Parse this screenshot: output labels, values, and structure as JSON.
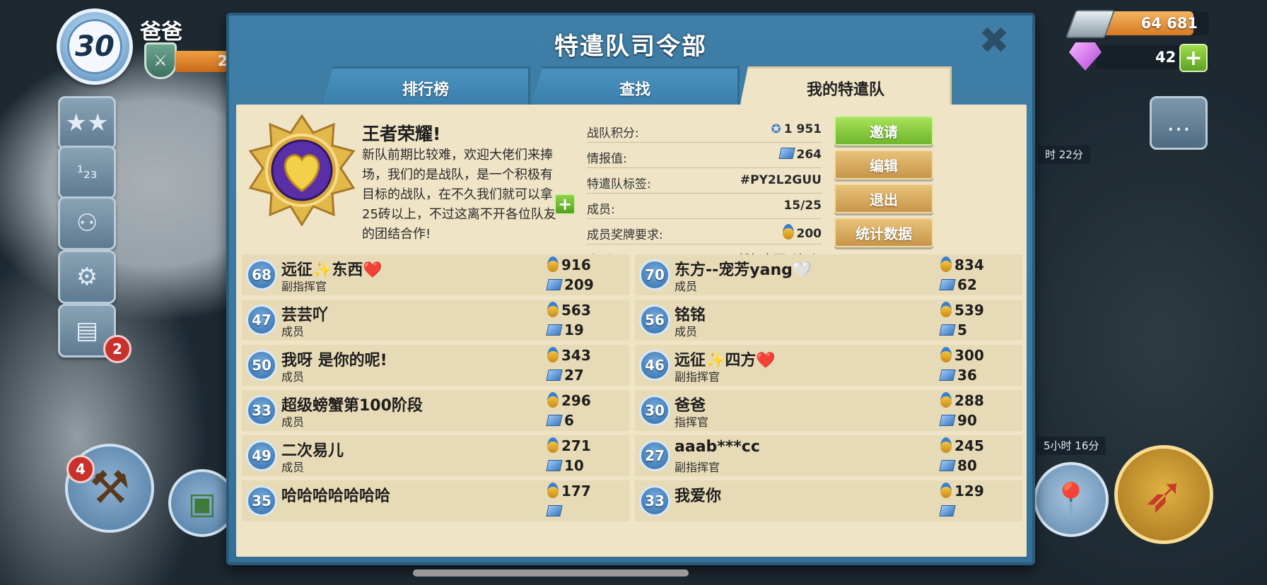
{
  "hud": {
    "player_level": "30",
    "player_name": "爸爸",
    "medal_partial": "2",
    "iron": "64 681",
    "gems": "42",
    "side_badge_count": "2",
    "builder_count": "4",
    "timer_1": "时 22分",
    "timer_2": "5小时 16分"
  },
  "panel": {
    "title": "特遣队司令部",
    "tabs": [
      "排行榜",
      "查找",
      "我的特遣队"
    ],
    "active_tab": 2
  },
  "team": {
    "name": "王者荣耀!",
    "description": "新队前期比较难，欢迎大佬们来捧场，我们的是战队，是一个积极有目标的战队，在不久我们就可以拿25砖以上，不过这离不开各位队友的团结合作!",
    "stats": [
      {
        "label": "战队积分:",
        "value": "1 951"
      },
      {
        "label": "情报值:",
        "value": "264"
      },
      {
        "label": "特遣队标签:",
        "value": "#PY2L2GUU"
      },
      {
        "label": "成员:",
        "value": "15/25"
      },
      {
        "label": "成员奖牌要求:",
        "value": "200"
      },
      {
        "label": "类型:",
        "value": "任何人可以加入"
      }
    ],
    "buttons": [
      "邀请",
      "编辑",
      "退出",
      "统计数据"
    ]
  },
  "members": [
    {
      "level": "68",
      "name": "远征✨东西❤️",
      "role": "副指挥官",
      "medals": "916",
      "intel": "209"
    },
    {
      "level": "70",
      "name": "东方--宠芳yang🤍",
      "role": "成员",
      "medals": "834",
      "intel": "62"
    },
    {
      "level": "47",
      "name": "芸芸吖",
      "role": "成员",
      "medals": "563",
      "intel": "19"
    },
    {
      "level": "56",
      "name": "铭铭",
      "role": "成员",
      "medals": "539",
      "intel": "5"
    },
    {
      "level": "50",
      "name": "我呀 是你的呢!",
      "role": "成员",
      "medals": "343",
      "intel": "27"
    },
    {
      "level": "46",
      "name": "远征✨四方❤️",
      "role": "副指挥官",
      "medals": "300",
      "intel": "36"
    },
    {
      "level": "33",
      "name": "超级螃蟹第100阶段",
      "role": "成员",
      "medals": "296",
      "intel": "6"
    },
    {
      "level": "30",
      "name": "爸爸",
      "role": "指挥官",
      "medals": "288",
      "intel": "90"
    },
    {
      "level": "49",
      "name": "二次易儿",
      "role": "成员",
      "medals": "271",
      "intel": "10"
    },
    {
      "level": "27",
      "name": "aaab***cc",
      "role": "副指挥官",
      "medals": "245",
      "intel": "80"
    },
    {
      "level": "35",
      "name": "哈哈哈哈哈哈哈",
      "role": "",
      "medals": "177",
      "intel": ""
    },
    {
      "level": "33",
      "name": "我爱你",
      "role": "",
      "medals": "129",
      "intel": ""
    }
  ],
  "colors": {
    "panel_blue": "#3f7ea6",
    "parchment": "#efe4c6",
    "button_green": "#6db62c",
    "button_tan": "#c89548"
  }
}
